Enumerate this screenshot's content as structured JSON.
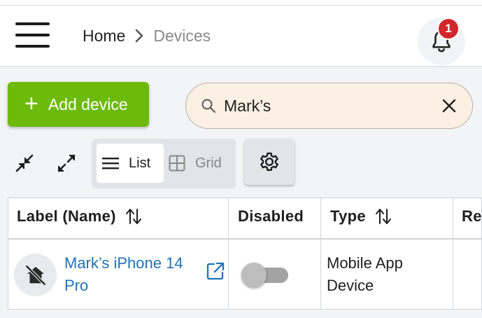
{
  "breadcrumb": {
    "home": "Home",
    "current": "Devices"
  },
  "notifications": {
    "count": "1"
  },
  "toolbar": {
    "add_label": "Add device"
  },
  "search": {
    "value": "Mark’s",
    "placeholder": ""
  },
  "view": {
    "list_label": "List",
    "grid_label": "Grid",
    "selected": "List"
  },
  "table": {
    "columns": [
      "Label (Name)",
      "Disabled",
      "Type",
      "Re"
    ],
    "rows": [
      {
        "label": "Mark’s iPhone 14 Pro",
        "disabled": false,
        "type": "Mobile App Device"
      }
    ]
  },
  "colors": {
    "accent_green": "#6dba0a",
    "link_blue": "#1f73b7",
    "badge_red": "#d3262c",
    "search_bg": "#fbf0e4"
  },
  "icons": [
    "menu-icon",
    "chevron-right-icon",
    "bell-icon",
    "plus-icon",
    "search-icon",
    "close-icon",
    "collapse-icon",
    "expand-icon",
    "list-icon",
    "grid-icon",
    "gear-icon",
    "sort-icon",
    "hidden-house-icon",
    "external-link-icon"
  ]
}
